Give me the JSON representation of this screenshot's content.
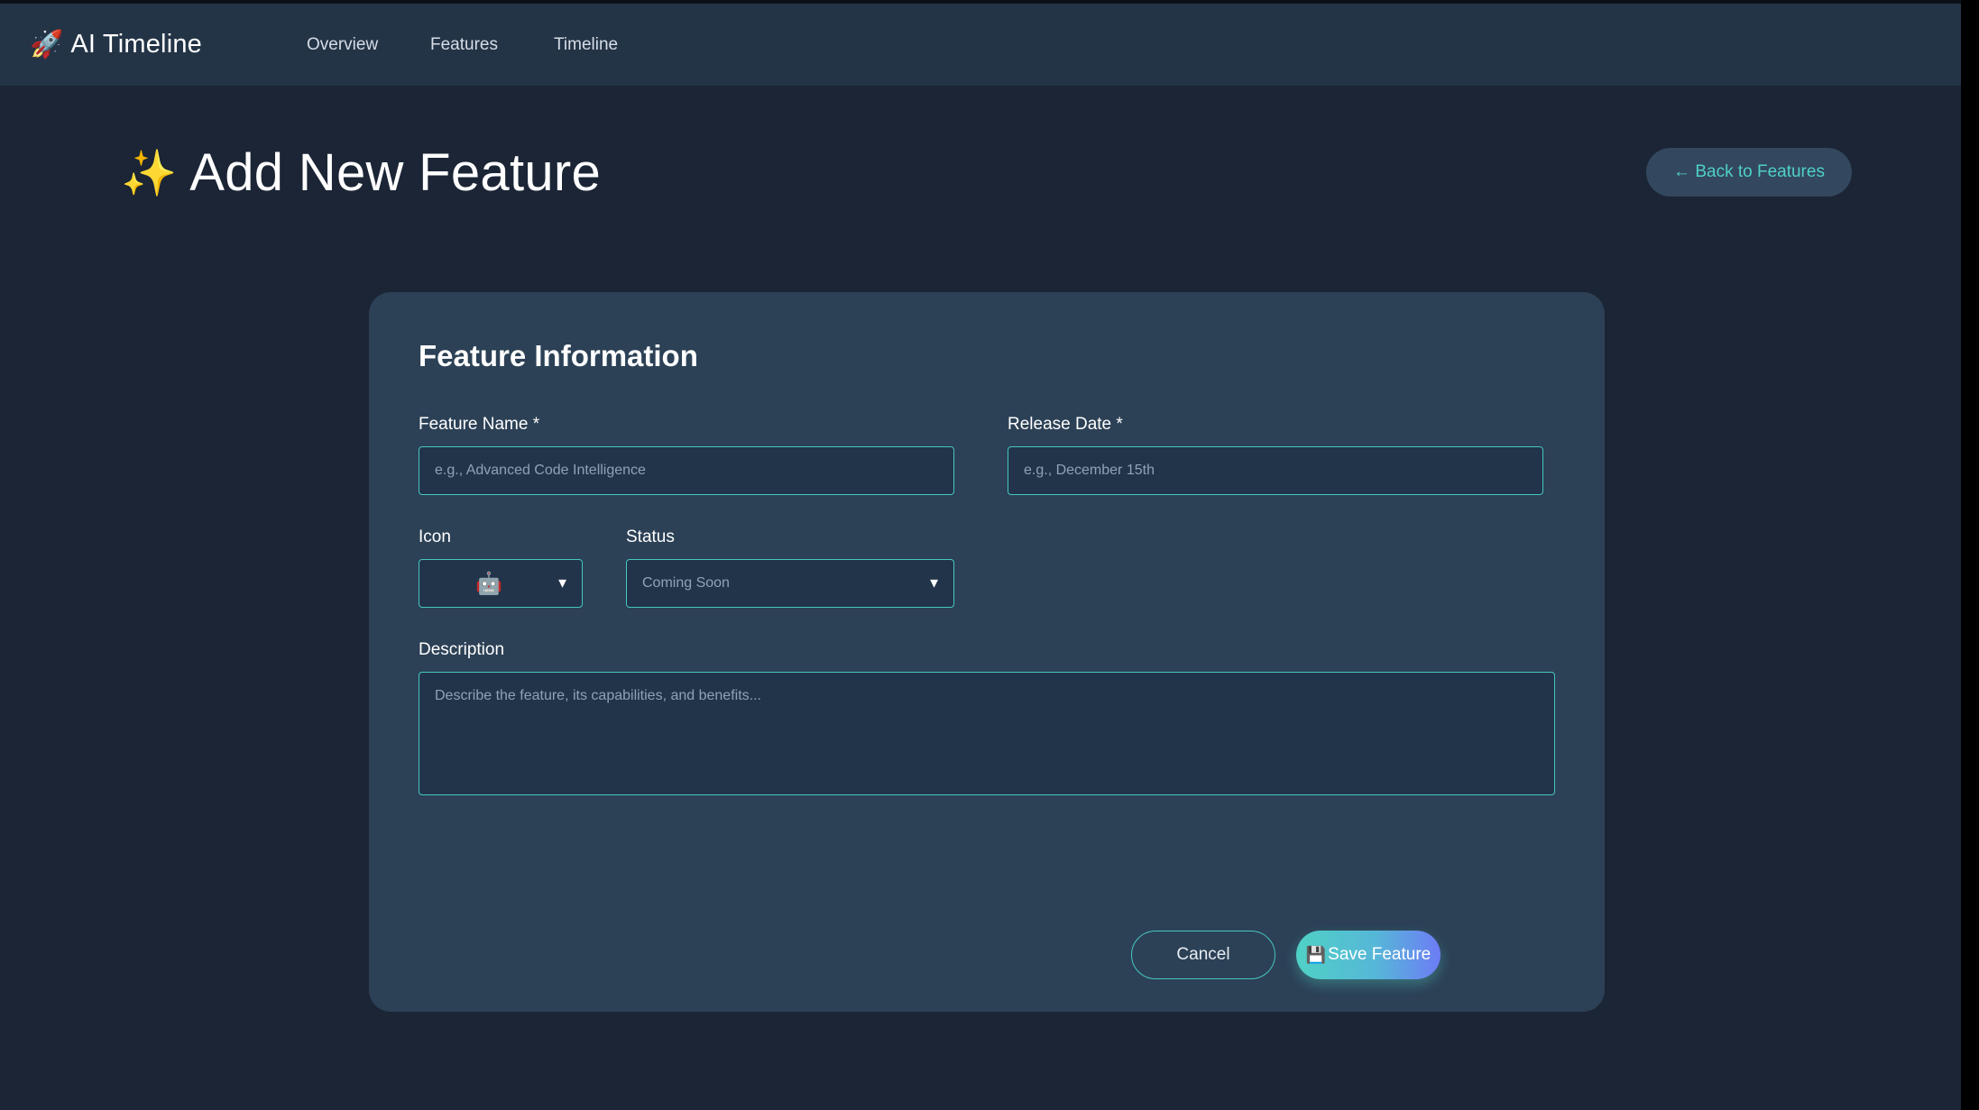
{
  "nav": {
    "brand_icon": "🚀",
    "brand": "AI Timeline",
    "links": [
      "Overview",
      "Features",
      "Timeline"
    ]
  },
  "header": {
    "title_icon": "✨",
    "title": "Add New Feature",
    "back_button": "← Back to Features"
  },
  "form": {
    "section_title": "Feature Information",
    "feature_name": {
      "label": "Feature Name *",
      "placeholder": "e.g., Advanced Code Intelligence"
    },
    "release_date": {
      "label": "Release Date *",
      "placeholder": "e.g., December 15th"
    },
    "icon": {
      "label": "Icon",
      "selected": "🤖",
      "icon_name": "robot-icon"
    },
    "status": {
      "label": "Status",
      "selected": "Coming Soon"
    },
    "description": {
      "label": "Description",
      "placeholder": "Describe the feature, its capabilities, and benefits..."
    },
    "caret": "▼",
    "cancel_label": "Cancel",
    "save_icon": "💾",
    "save_label": "Save Feature"
  },
  "colors": {
    "background": "#1b2535",
    "navbar": "#243447",
    "card": "#2c4156",
    "accent": "#4fd1c5",
    "gradient_end": "#6d7cf5"
  }
}
